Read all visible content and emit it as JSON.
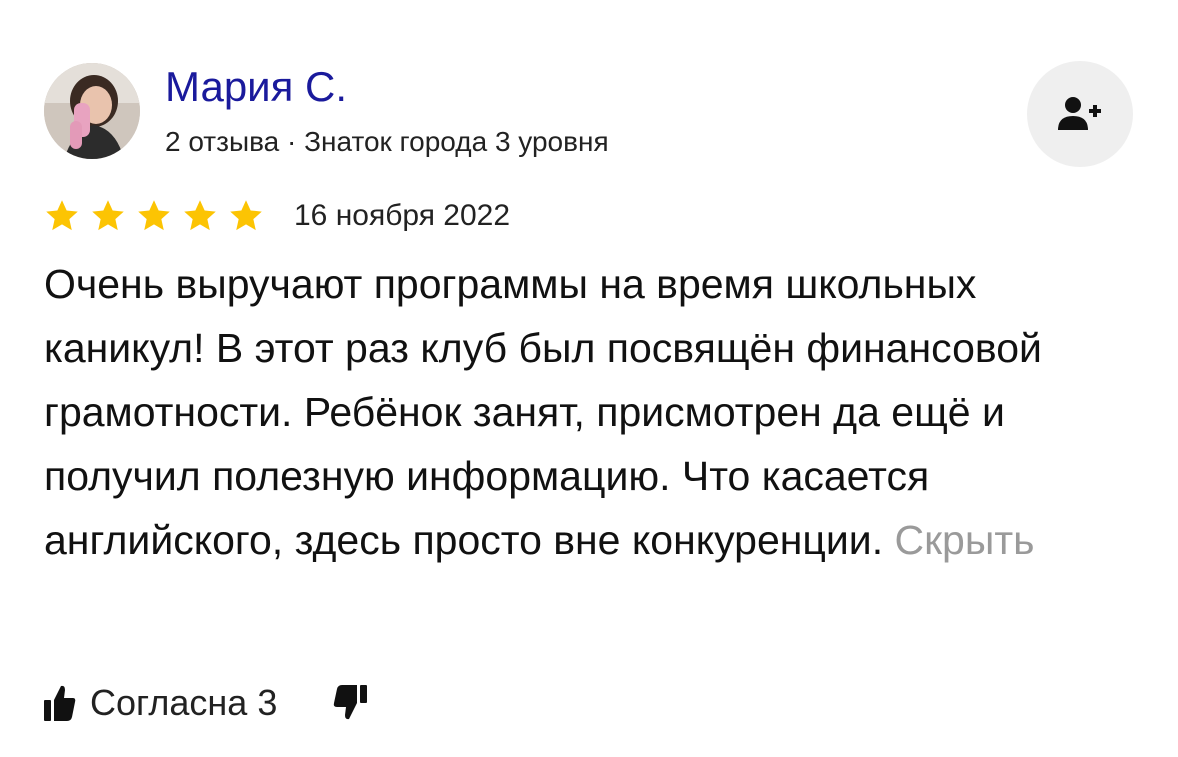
{
  "author": {
    "name": "Мария С.",
    "meta": "2 отзыва · Знаток города 3 уровня",
    "avatar_icon": "avatar-photo"
  },
  "subscribe": {
    "icon": "add-user-icon"
  },
  "review": {
    "rating": 5,
    "rating_max": 5,
    "star_color": "#fcc403",
    "date": "16 ноября 2022",
    "text": "Очень выручают программы на время школьных каникул! В этот раз клуб был посвящён финансовой грамотности. Ребёнок занят, присмотрен да ещё и получил полезную информацию. Что касается английского, здесь просто вне конкуренции.",
    "hide_label": "Скрыть"
  },
  "reactions": {
    "like_label": "Согласна",
    "like_count": "3",
    "like_icon": "thumbs-up-icon",
    "dislike_icon": "thumbs-down-icon"
  },
  "colors": {
    "author_link": "#1a1a9c",
    "muted_link": "#9a9a9a",
    "button_bg": "#efefef"
  }
}
